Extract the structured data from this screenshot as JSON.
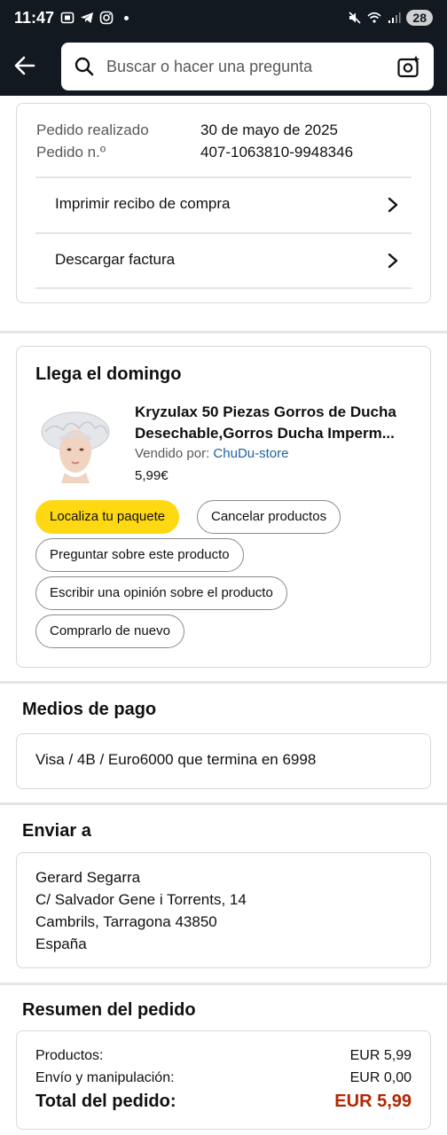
{
  "status_bar": {
    "time": "11:47",
    "battery": "28"
  },
  "header": {
    "search_placeholder": "Buscar o hacer una pregunta"
  },
  "order_info": {
    "placed_label": "Pedido realizado",
    "placed_value": "30 de mayo de 2025",
    "number_label": "Pedido n.º",
    "number_value": "407-1063810-9948346",
    "links": [
      {
        "label": "Imprimir recibo de compra"
      },
      {
        "label": "Descargar factura"
      }
    ]
  },
  "shipment": {
    "title": "Llega el domingo",
    "product_title": "Kryzulax 50 Piezas Gorros de Ducha Desechable,Gorros Ducha Imperm...",
    "sold_by_label": "Vendido por:",
    "seller": "ChuDu-store",
    "price": "5,99€",
    "buttons": {
      "track": "Localiza tu paquete",
      "cancel": "Cancelar productos",
      "ask": "Preguntar sobre este producto",
      "review": "Escribir una opinión sobre el producto",
      "rebuy": "Comprarlo de nuevo"
    }
  },
  "payment": {
    "title": "Medios de pago",
    "method": "Visa / 4B / Euro6000  que termina en 6998"
  },
  "shipping": {
    "title": "Enviar a",
    "lines": [
      "Gerard Segarra",
      "C/ Salvador Gene i Torrents, 14",
      "Cambrils, Tarragona 43850",
      "España"
    ]
  },
  "summary": {
    "title": "Resumen del pedido",
    "products_label": "Productos:",
    "products_value": "EUR 5,99",
    "shipping_label": "Envío y manipulación:",
    "shipping_value": "EUR 0,00",
    "total_label": "Total del pedido:",
    "total_value": "EUR 5,99"
  },
  "colors": {
    "header_bg": "#131921",
    "primary_button": "#ffd814",
    "link": "#2162a1",
    "total_price": "#b12704"
  }
}
